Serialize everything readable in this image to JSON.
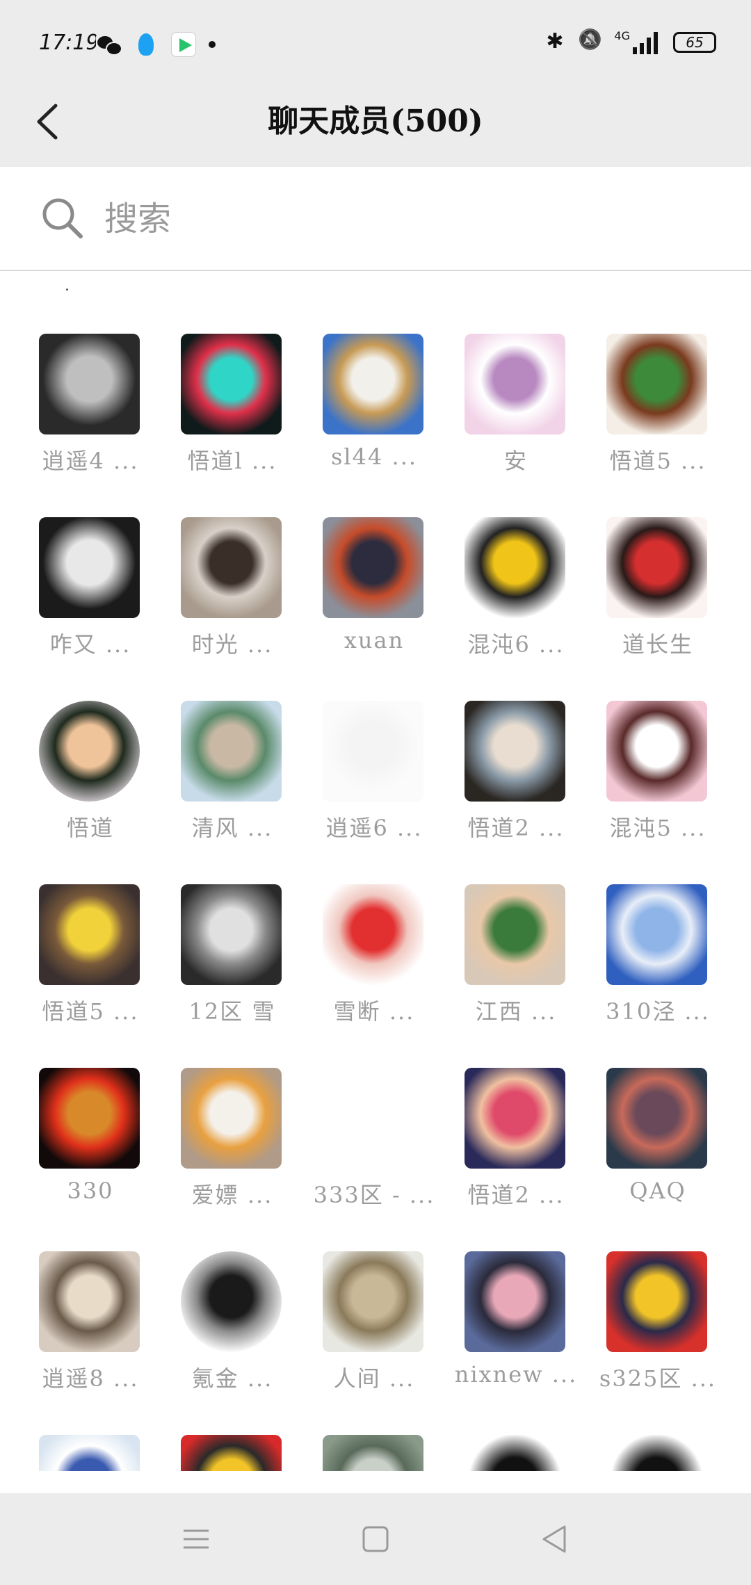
{
  "status_bar": {
    "time": "17:19",
    "network": "4G",
    "battery": "65",
    "icons": [
      "wechat-icon",
      "qq-icon",
      "video-app-icon",
      "notification-dot",
      "bluetooth-icon",
      "mute-bell-icon",
      "signal-icon",
      "battery-icon"
    ]
  },
  "header": {
    "title": "聊天成员(500)",
    "back_icon": "chevron-left-icon"
  },
  "search": {
    "placeholder": "搜索",
    "icon": "search-icon"
  },
  "members": [
    {
      "name": "逍遥4 ...",
      "colors": [
        "#2a2a2a",
        "#bfbfbf"
      ]
    },
    {
      "name": "悟道l ...",
      "colors": [
        "#0f1a1a",
        "#2fd6c8",
        "#e0304a"
      ]
    },
    {
      "name": "sl44 ...",
      "colors": [
        "#3b73c9",
        "#f2f0ea",
        "#c79a55"
      ]
    },
    {
      "name": "安",
      "colors": [
        "#f2d4e8",
        "#b888c0",
        "#ffffff"
      ]
    },
    {
      "name": "悟道5 ...",
      "colors": [
        "#f4eee6",
        "#3d8a3a",
        "#7a3a1e"
      ]
    },
    {
      "name": "咋又 ...",
      "colors": [
        "#1b1b1b",
        "#e8e8e8"
      ]
    },
    {
      "name": "时光 ...",
      "colors": [
        "#a89a8c",
        "#3a2e28",
        "#d8d0c8"
      ]
    },
    {
      "name": "xuan",
      "colors": [
        "#8b8f99",
        "#2c2c3e",
        "#c74c2a"
      ]
    },
    {
      "name": "混沌6 ...",
      "colors": [
        "#ffffff",
        "#f0c418",
        "#222222"
      ]
    },
    {
      "name": "道长生",
      "colors": [
        "#fbf2f2",
        "#d62f2f",
        "#2a1a18"
      ]
    },
    {
      "name": "悟道",
      "colors": [
        "#c9c3c8",
        "#f0c49a",
        "#1f2a1e"
      ]
    },
    {
      "name": "清风 ...",
      "colors": [
        "#c7dbe8",
        "#c8b8a4",
        "#5a8a6a"
      ]
    },
    {
      "name": "逍遥6 ...",
      "colors": [
        "#fbfbfb",
        "#f4f4f4"
      ]
    },
    {
      "name": "悟道2 ...",
      "colors": [
        "#2a2622",
        "#e8ddd0",
        "#8a9aa8"
      ]
    },
    {
      "name": "混沌5 ...",
      "colors": [
        "#f3c8d4",
        "#ffffff",
        "#5a2a2a"
      ]
    },
    {
      "name": "悟道5 ...",
      "colors": [
        "#3a3030",
        "#f2d23a",
        "#7a5a3a"
      ]
    },
    {
      "name": "12区 雪",
      "colors": [
        "#2a2a2a",
        "#e0e0e0",
        "#8a8a8a"
      ]
    },
    {
      "name": "雪断 ...",
      "colors": [
        "#ffffff",
        "#e23030",
        "#f0c8c0"
      ]
    },
    {
      "name": "江西 ...",
      "colors": [
        "#d8c8b8",
        "#3a7a3a",
        "#e8c8a8"
      ]
    },
    {
      "name": "310泾 ...",
      "colors": [
        "#2f5fbf",
        "#8fb4e8",
        "#e8eef8"
      ]
    },
    {
      "name": "330",
      "colors": [
        "#120a0a",
        "#d88a2a",
        "#e0301a"
      ]
    },
    {
      "name": "爱嫖 ...",
      "colors": [
        "#b09a88",
        "#f4f0ea",
        "#e8a040"
      ]
    },
    {
      "name": "333区 - ...",
      "colors": [
        "#ffffff",
        "#ffffff"
      ]
    },
    {
      "name": "悟道2 ...",
      "colors": [
        "#2a2a5a",
        "#e04a6a",
        "#f0c0a0"
      ]
    },
    {
      "name": "QAQ",
      "colors": [
        "#2a3a4a",
        "#6a4a5a",
        "#c86a5a"
      ]
    },
    {
      "name": "逍遥8 ...",
      "colors": [
        "#d8ccc0",
        "#e8dcc8",
        "#6a5a4a"
      ]
    },
    {
      "name": "氪金 ...",
      "colors": [
        "#ffffff",
        "#1a1a1a",
        "#8a8a8a"
      ]
    },
    {
      "name": "人间 ...",
      "colors": [
        "#e8e8e2",
        "#c8b898",
        "#8a7a5a"
      ]
    },
    {
      "name": "nixnew ...",
      "colors": [
        "#5a6a9a",
        "#e8a8b8",
        "#2a2a3a"
      ]
    },
    {
      "name": "s325区 ...",
      "colors": [
        "#d8302a",
        "#f2c428",
        "#2a2a4a"
      ]
    },
    {
      "name": "",
      "colors": [
        "#d8e4f0",
        "#3a5ab0",
        "#ffffff"
      ]
    },
    {
      "name": "",
      "colors": [
        "#d82a2a",
        "#f2c428",
        "#2a2a2a"
      ]
    },
    {
      "name": "",
      "colors": [
        "#8a9a8a",
        "#c8d0c8",
        "#5a6a5a"
      ]
    },
    {
      "name": "",
      "colors": [
        "#ffffff",
        "#111111"
      ]
    },
    {
      "name": "",
      "colors": [
        "#ffffff",
        "#111111"
      ]
    }
  ],
  "nav": {
    "icons": [
      "menu-icon",
      "home-square-icon",
      "back-triangle-icon"
    ]
  }
}
